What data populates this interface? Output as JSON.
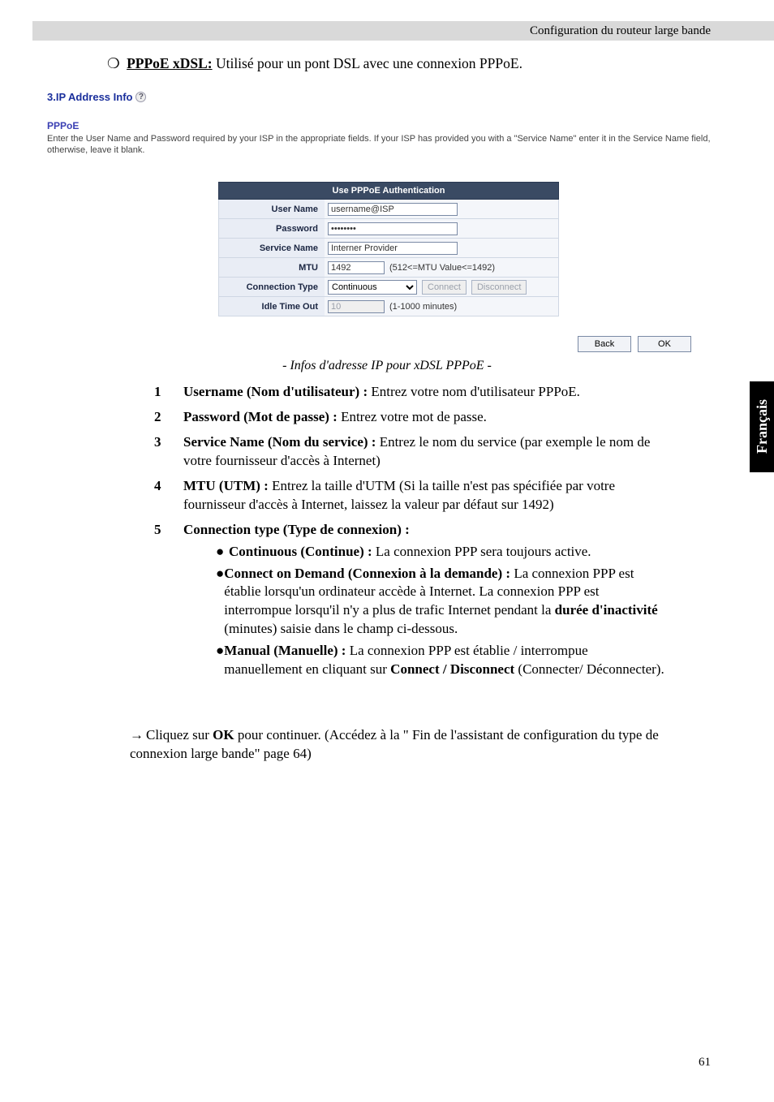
{
  "header": "Configuration du routeur large bande",
  "pppox": {
    "title": "PPPoE xDSL:",
    "desc": "Utilisé pour un pont DSL avec une connexion PPPoE."
  },
  "section_head": "3.IP Address Info",
  "pppoe_label": "PPPoE",
  "pppoe_desc": "Enter the User Name and Password required by your ISP in the appropriate fields. If your ISP has provided you with a \"Service Name\" enter it in the Service Name field, otherwise, leave it blank.",
  "form": {
    "title": "Use PPPoE Authentication",
    "rows": {
      "username": {
        "label": "User Name",
        "value": "username@ISP"
      },
      "password": {
        "label": "Password",
        "value": "••••••••"
      },
      "service": {
        "label": "Service Name",
        "value": "Interner Provider"
      },
      "mtu": {
        "label": "MTU",
        "value": "1492",
        "hint": "(512<=MTU Value<=1492)"
      },
      "conn": {
        "label": "Connection Type",
        "value": "Continuous",
        "connect": "Connect",
        "disconnect": "Disconnect"
      },
      "idle": {
        "label": "Idle Time Out",
        "value": "10",
        "hint": "(1-1000 minutes)"
      }
    }
  },
  "buttons": {
    "back": "Back",
    "ok": "OK"
  },
  "caption": "- Infos d'adresse IP pour xDSL PPPoE -",
  "items": [
    {
      "n": "1",
      "b": "Username (Nom d'utilisateur) : ",
      "t": "Entrez votre nom d'utilisateur PPPoE."
    },
    {
      "n": "2",
      "b": "Password (Mot de passe) : ",
      "t": "Entrez votre mot de passe."
    },
    {
      "n": "3",
      "b": "Service Name (Nom du service) : ",
      "t": "Entrez le nom du service (par exemple le nom de votre fournisseur d'accès à Internet)"
    },
    {
      "n": "4",
      "b": "MTU (UTM) : ",
      "t": "Entrez la taille d'UTM (Si la taille n'est pas spécifiée par votre fournisseur d'accès à Internet, laissez la valeur par défaut sur 1492)"
    }
  ],
  "item5": {
    "n": "5",
    "b": "Connection type (Type de connexion) :",
    "bullets": {
      "a": {
        "b": "Continuous (Continue) : ",
        "t": "La connexion PPP sera toujours active."
      },
      "b": {
        "b1": "Connect on Demand (Connexion à la demande) : ",
        "t1": "La connexion PPP est établie lorsqu'un ordinateur accède à Internet. La connexion PPP est interrompue lorsqu'il n'y a plus de trafic Internet pendant la ",
        "b2": "durée d'inactivité",
        "t2": " (minutes) saisie dans le champ ci-dessous."
      },
      "c": {
        "b1": "Manual (Manuelle) : ",
        "t1": "La connexion PPP est établie / interrompue manuellement en cliquant sur ",
        "b2": "Connect / Disconnect",
        "t2": " (Connecter/ Déconnecter)."
      }
    }
  },
  "arrow": {
    "pre": "Cliquez sur ",
    "b": "OK",
    "post": " pour continuer. (Accédez à la \" Fin de l'assistant de configuration du type de connexion large bande\" page 64)"
  },
  "side_tab": "Français",
  "page_number": "61"
}
